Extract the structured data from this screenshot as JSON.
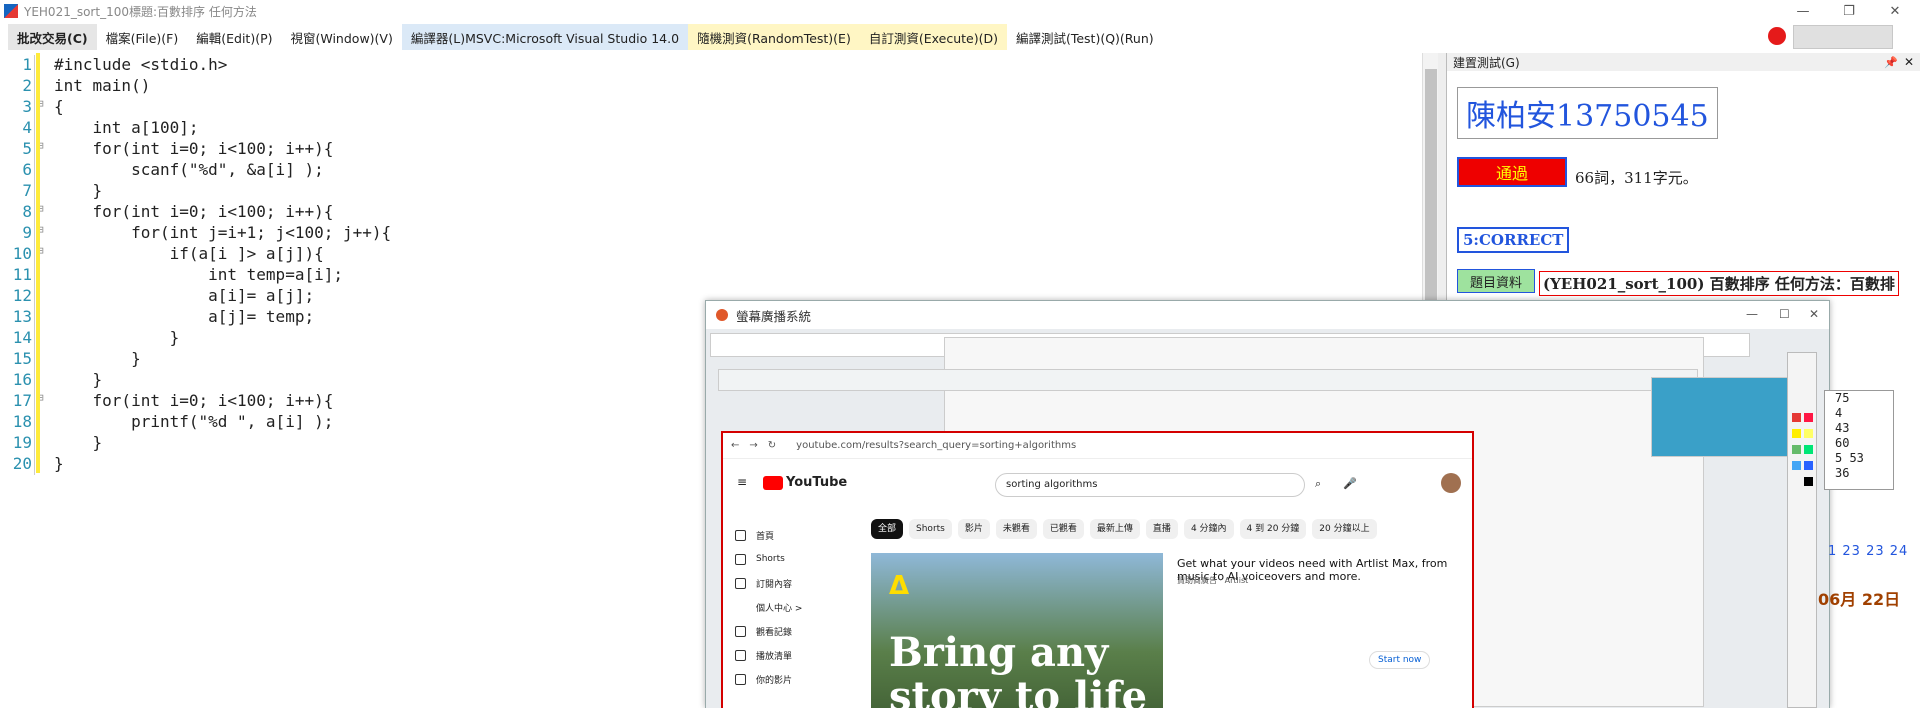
{
  "window": {
    "title": "YEH021_sort_100標題:百數排序 任何方法"
  },
  "menu": [
    {
      "label": "批改交易(C)"
    },
    {
      "label": "檔案(File)(F)"
    },
    {
      "label": "編輯(Edit)(P)"
    },
    {
      "label": "視窗(Window)(V)"
    },
    {
      "label": "編譯器(L)MSVC:Microsoft Visual Studio 14.0"
    },
    {
      "label": "隨機測資(RandomTest)(E)"
    },
    {
      "label": "自訂測資(Execute)(D)"
    },
    {
      "label": "編譯測試(Test)(Q)(Run)"
    }
  ],
  "code": {
    "line_numbers": [
      "1",
      "2",
      "3",
      "4",
      "5",
      "6",
      "7",
      "8",
      "9",
      "10",
      "11",
      "12",
      "13",
      "14",
      "15",
      "16",
      "17",
      "18",
      "19",
      "20"
    ],
    "lines": [
      "#include <stdio.h>",
      "int main()",
      "{",
      "    int a[100];",
      "    for(int i=0; i<100; i++){",
      "        scanf(\"%d\", &a[i] );",
      "    }",
      "    for(int i=0; i<100; i++){",
      "        for(int j=i+1; j<100; j++){",
      "            if(a[i ]> a[j]){",
      "                int temp=a[i];",
      "                a[i]= a[j];",
      "                a[j]= temp;",
      "            }",
      "        }",
      "    }",
      "    for(int i=0; i<100; i++){",
      "        printf(\"%d \", a[i] );",
      "    }",
      "}"
    ]
  },
  "panel": {
    "title": "建置測試(G)",
    "student_name": "陳柏安13750545",
    "pass_label": "通過",
    "stats": "66詞，311字元。",
    "correct_label": "5:CORRECT",
    "info_button": "題目資料",
    "problem_title": "(YEH021_sort_100) 百數排序 任何方法：百數排"
  },
  "overlay": {
    "title": "螢幕廣播系統",
    "youtube": {
      "url": "youtube.com/results?search_query=sorting+algorithms",
      "logo": "YouTube",
      "search_value": "sorting algorithms",
      "chips": [
        "全部",
        "Shorts",
        "影片",
        "未觀看",
        "已觀看",
        "最新上傳",
        "直播",
        "4 分鐘內",
        "4 到 20 分鐘",
        "20 分鐘以上"
      ],
      "sidebar": [
        "首頁",
        "Shorts",
        "訂閱內容",
        "個人中心 >",
        "觀看記錄",
        "播放清單",
        "你的影片"
      ],
      "ad_headline": "Bring any story to life",
      "ad_title": "Get what your videos need with Artlist Max, from music to AI voiceovers and more.",
      "ad_sponsor": "贊助商廣告 · Artlist",
      "ad_cta": "Start now"
    }
  },
  "side_list": {
    "values": [
      "75",
      "4",
      "43",
      "60",
      "5 53",
      "36"
    ]
  },
  "side_numbers": "1 23 23 24",
  "side_date": "06月 22日",
  "colors": {
    "accent_blue": "#2255dd",
    "pass_red": "#ee0000",
    "menu_blue": "#dbe9f7",
    "menu_yellow": "#fff6c4"
  }
}
